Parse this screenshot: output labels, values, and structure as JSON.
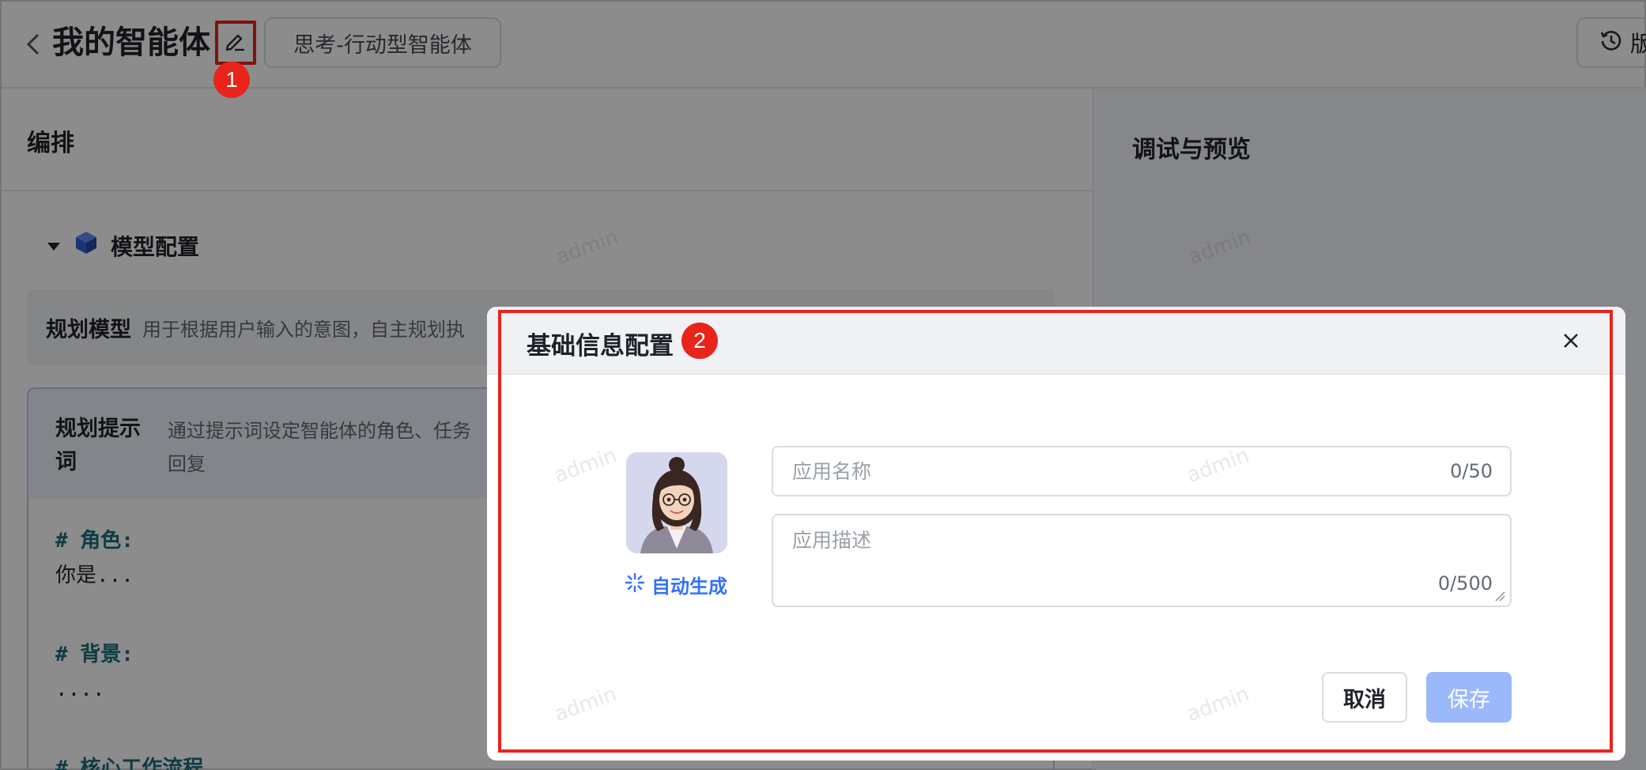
{
  "header": {
    "title": "我的智能体",
    "type_tag": "思考-行动型智能体",
    "version_label": "版"
  },
  "left_panel": {
    "title": "编排",
    "model_section": {
      "title": "模型配置",
      "row_label": "规划模型",
      "row_desc": "用于根据用户输入的意图，自主规划执"
    },
    "prompt": {
      "label": "规划提示词",
      "desc_line1": "通过提示词设定智能体的角色、任务",
      "desc_line2": "回复",
      "role_heading": "# 角色:",
      "role_text": "你是...",
      "bg_heading": "# 背景:",
      "bg_text": "....",
      "workflow_heading": "# 核心工作流程"
    }
  },
  "right_panel": {
    "title": "调试与预览"
  },
  "watermark": "admin",
  "dialog": {
    "title": "基础信息配置",
    "auto_generate": "自动生成",
    "name_placeholder": "应用名称",
    "name_counter": "0/50",
    "desc_placeholder": "应用描述",
    "desc_counter": "0/500",
    "cancel": "取消",
    "save": "保存"
  },
  "annotations": {
    "marker_1": "1",
    "marker_2": "2"
  },
  "colors": {
    "annotation_red": "#e8241b",
    "primary_blue": "#3370ff",
    "save_disabled": "#9bb8fb"
  }
}
